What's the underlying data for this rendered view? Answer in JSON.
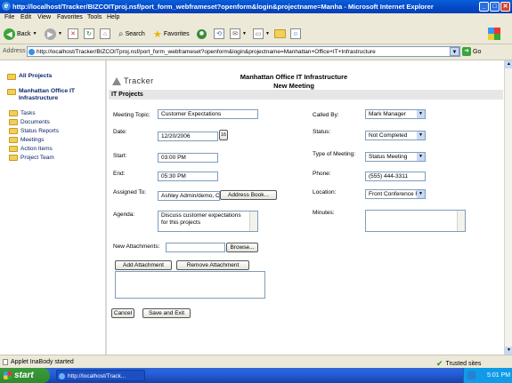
{
  "window": {
    "title": "http://localhost/Tracker/BIZCOITproj.nsf/port_form_webframeset?openform&login&projectname=Manha - Microsoft Internet Explorer"
  },
  "menu": [
    "File",
    "Edit",
    "View",
    "Favorites",
    "Tools",
    "Help"
  ],
  "toolbar": {
    "back": "Back",
    "search": "Search",
    "favorites": "Favorites"
  },
  "address": {
    "label": "Address",
    "url": "http://localhost/Tracker/BIZCOITproj.nsf/port_form_webframeset?openform&login&projectname=Manhattan+Office+IT+Infrastructure",
    "go": "Go"
  },
  "nav": {
    "all_projects": "All Projects",
    "project": "Manhattan Office IT Infrastructure",
    "items": [
      "Tasks",
      "Documents",
      "Status Reports",
      "Meetings",
      "Action Items",
      "Project Team"
    ]
  },
  "header": {
    "logo": "Tracker",
    "title": "Manhattan Office IT Infrastructure",
    "subtitle": "New Meeting",
    "section": "IT Projects"
  },
  "form": {
    "meeting_topic_label": "Meeting Topic:",
    "meeting_topic": "Customer Expectations",
    "date_label": "Date:",
    "date": "12/20/2006",
    "calendar_icon": "16",
    "start_label": "Start:",
    "start": "03:00 PM",
    "end_label": "End:",
    "end": "05:30 PM",
    "assigned_label": "Assigned To:",
    "assigned": "Ashley Admin/demo, Cai",
    "address_book": "Address Book...",
    "agenda_label": "Agenda:",
    "agenda": "Discuss customer expectations for this projects",
    "called_by_label": "Called By:",
    "called_by": "Mark Manager",
    "status_label": "Status:",
    "status": "Not Completed",
    "type_label": "Type of Meeting:",
    "type": "Status Meeting",
    "phone_label": "Phone:",
    "phone": "(555) 444-3311",
    "location_label": "Location:",
    "location": "Front Conference R",
    "minutes_label": "Minutes:",
    "new_attachments_label": "New Attachments:",
    "browse": "Browse...",
    "add_attachment": "Add Attachment",
    "remove_attachment": "Remove Attachment",
    "cancel": "Cancel",
    "save_exit": "Save and Exit"
  },
  "status": {
    "text": "Applet InaBody started",
    "zone": "Trusted sites"
  },
  "taskbar": {
    "start": "start",
    "item": "http://localhost/Track...",
    "clock": "5:01 PM"
  }
}
